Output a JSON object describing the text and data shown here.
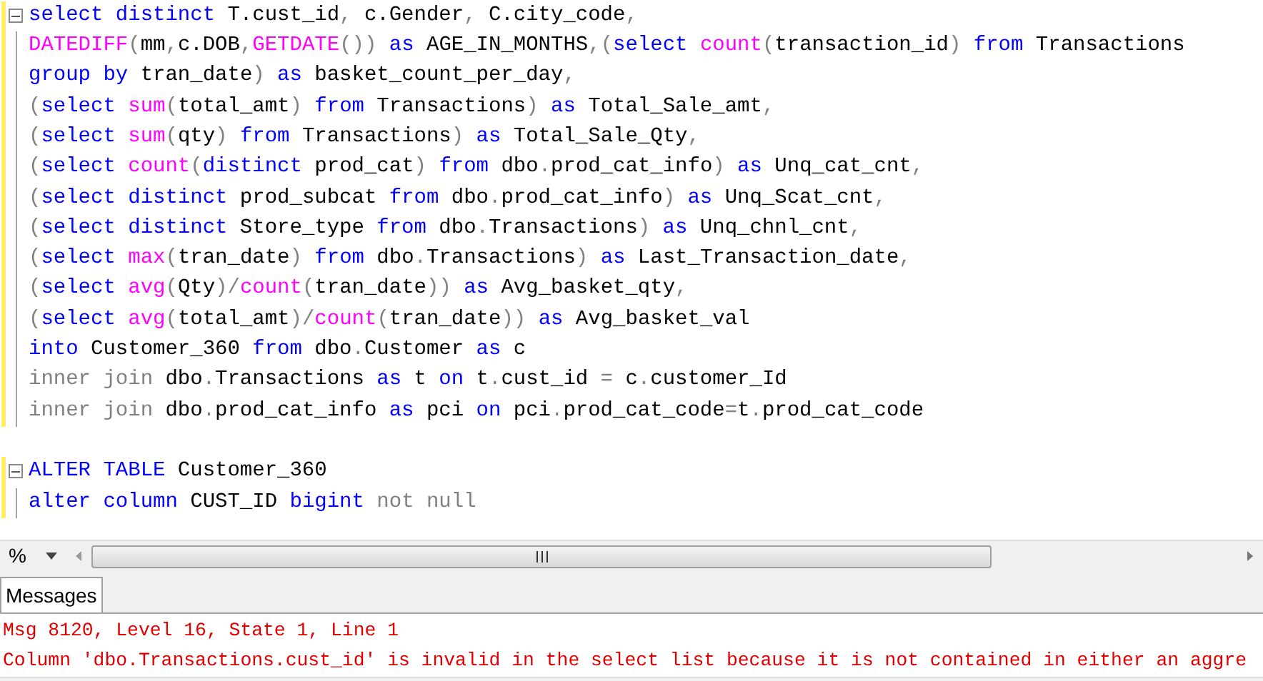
{
  "editor": {
    "blocks": [
      {
        "expanded": true,
        "lines": [
          {
            "tokens": [
              {
                "kind": "keyword",
                "text": "select distinct"
              },
              {
                "kind": "name",
                "text": " T.cust_id"
              },
              {
                "kind": "operator",
                "text": ","
              },
              {
                "kind": "name",
                "text": " c.Gender"
              },
              {
                "kind": "operator",
                "text": ","
              },
              {
                "kind": "name",
                "text": " C.city_code"
              },
              {
                "kind": "operator",
                "text": ","
              }
            ]
          },
          {
            "tokens": [
              {
                "kind": "function",
                "text": "DATEDIFF"
              },
              {
                "kind": "operator",
                "text": "("
              },
              {
                "kind": "name",
                "text": "mm"
              },
              {
                "kind": "operator",
                "text": ","
              },
              {
                "kind": "name",
                "text": "c.DOB"
              },
              {
                "kind": "operator",
                "text": ","
              },
              {
                "kind": "function",
                "text": "GETDATE"
              },
              {
                "kind": "operator",
                "text": "())"
              },
              {
                "kind": "keyword",
                "text": " as"
              },
              {
                "kind": "name",
                "text": " AGE_IN_MONTHS"
              },
              {
                "kind": "operator",
                "text": ",("
              },
              {
                "kind": "keyword",
                "text": "select"
              },
              {
                "kind": "function",
                "text": " count"
              },
              {
                "kind": "operator",
                "text": "("
              },
              {
                "kind": "name",
                "text": "transaction_id"
              },
              {
                "kind": "operator",
                "text": ")"
              },
              {
                "kind": "keyword",
                "text": " from"
              },
              {
                "kind": "name",
                "text": " Transactions"
              }
            ]
          },
          {
            "tokens": [
              {
                "kind": "keyword",
                "text": "group by"
              },
              {
                "kind": "name",
                "text": " tran_date"
              },
              {
                "kind": "operator",
                "text": ")"
              },
              {
                "kind": "keyword",
                "text": " as"
              },
              {
                "kind": "name",
                "text": " basket_count_per_day"
              },
              {
                "kind": "operator",
                "text": ","
              }
            ]
          },
          {
            "tokens": [
              {
                "kind": "operator",
                "text": "("
              },
              {
                "kind": "keyword",
                "text": "select"
              },
              {
                "kind": "function",
                "text": " sum"
              },
              {
                "kind": "operator",
                "text": "("
              },
              {
                "kind": "name",
                "text": "total_amt"
              },
              {
                "kind": "operator",
                "text": ")"
              },
              {
                "kind": "keyword",
                "text": " from"
              },
              {
                "kind": "name",
                "text": " Transactions"
              },
              {
                "kind": "operator",
                "text": ")"
              },
              {
                "kind": "keyword",
                "text": " as"
              },
              {
                "kind": "name",
                "text": " Total_Sale_amt"
              },
              {
                "kind": "operator",
                "text": ","
              }
            ]
          },
          {
            "tokens": [
              {
                "kind": "operator",
                "text": "("
              },
              {
                "kind": "keyword",
                "text": "select"
              },
              {
                "kind": "function",
                "text": " sum"
              },
              {
                "kind": "operator",
                "text": "("
              },
              {
                "kind": "name",
                "text": "qty"
              },
              {
                "kind": "operator",
                "text": ")"
              },
              {
                "kind": "keyword",
                "text": " from"
              },
              {
                "kind": "name",
                "text": " Transactions"
              },
              {
                "kind": "operator",
                "text": ")"
              },
              {
                "kind": "keyword",
                "text": " as"
              },
              {
                "kind": "name",
                "text": " Total_Sale_Qty"
              },
              {
                "kind": "operator",
                "text": ","
              }
            ]
          },
          {
            "tokens": [
              {
                "kind": "operator",
                "text": "("
              },
              {
                "kind": "keyword",
                "text": "select"
              },
              {
                "kind": "function",
                "text": " count"
              },
              {
                "kind": "operator",
                "text": "("
              },
              {
                "kind": "keyword",
                "text": "distinct"
              },
              {
                "kind": "name",
                "text": " prod_cat"
              },
              {
                "kind": "operator",
                "text": ")"
              },
              {
                "kind": "keyword",
                "text": " from"
              },
              {
                "kind": "name",
                "text": " dbo"
              },
              {
                "kind": "operator",
                "text": "."
              },
              {
                "kind": "name",
                "text": "prod_cat_info"
              },
              {
                "kind": "operator",
                "text": ")"
              },
              {
                "kind": "keyword",
                "text": " as"
              },
              {
                "kind": "name",
                "text": " Unq_cat_cnt"
              },
              {
                "kind": "operator",
                "text": ","
              }
            ]
          },
          {
            "tokens": [
              {
                "kind": "operator",
                "text": "("
              },
              {
                "kind": "keyword",
                "text": "select distinct"
              },
              {
                "kind": "name",
                "text": " prod_subcat"
              },
              {
                "kind": "keyword",
                "text": " from"
              },
              {
                "kind": "name",
                "text": " dbo"
              },
              {
                "kind": "operator",
                "text": "."
              },
              {
                "kind": "name",
                "text": "prod_cat_info"
              },
              {
                "kind": "operator",
                "text": ")"
              },
              {
                "kind": "keyword",
                "text": " as"
              },
              {
                "kind": "name",
                "text": " Unq_Scat_cnt"
              },
              {
                "kind": "operator",
                "text": ","
              }
            ]
          },
          {
            "tokens": [
              {
                "kind": "operator",
                "text": "("
              },
              {
                "kind": "keyword",
                "text": "select distinct"
              },
              {
                "kind": "name",
                "text": " Store_type"
              },
              {
                "kind": "keyword",
                "text": " from"
              },
              {
                "kind": "name",
                "text": " dbo"
              },
              {
                "kind": "operator",
                "text": "."
              },
              {
                "kind": "name",
                "text": "Transactions"
              },
              {
                "kind": "operator",
                "text": ")"
              },
              {
                "kind": "keyword",
                "text": " as"
              },
              {
                "kind": "name",
                "text": " Unq_chnl_cnt"
              },
              {
                "kind": "operator",
                "text": ","
              }
            ]
          },
          {
            "tokens": [
              {
                "kind": "operator",
                "text": "("
              },
              {
                "kind": "keyword",
                "text": "select"
              },
              {
                "kind": "function",
                "text": " max"
              },
              {
                "kind": "operator",
                "text": "("
              },
              {
                "kind": "name",
                "text": "tran_date"
              },
              {
                "kind": "operator",
                "text": ")"
              },
              {
                "kind": "keyword",
                "text": " from"
              },
              {
                "kind": "name",
                "text": " dbo"
              },
              {
                "kind": "operator",
                "text": "."
              },
              {
                "kind": "name",
                "text": "Transactions"
              },
              {
                "kind": "operator",
                "text": ")"
              },
              {
                "kind": "keyword",
                "text": " as"
              },
              {
                "kind": "name",
                "text": " Last_Transaction_date"
              },
              {
                "kind": "operator",
                "text": ","
              }
            ]
          },
          {
            "tokens": [
              {
                "kind": "operator",
                "text": "("
              },
              {
                "kind": "keyword",
                "text": "select"
              },
              {
                "kind": "function",
                "text": " avg"
              },
              {
                "kind": "operator",
                "text": "("
              },
              {
                "kind": "name",
                "text": "Qty"
              },
              {
                "kind": "operator",
                "text": ")/"
              },
              {
                "kind": "function",
                "text": "count"
              },
              {
                "kind": "operator",
                "text": "("
              },
              {
                "kind": "name",
                "text": "tran_date"
              },
              {
                "kind": "operator",
                "text": "))"
              },
              {
                "kind": "keyword",
                "text": " as"
              },
              {
                "kind": "name",
                "text": " Avg_basket_qty"
              },
              {
                "kind": "operator",
                "text": ","
              }
            ]
          },
          {
            "tokens": [
              {
                "kind": "operator",
                "text": "("
              },
              {
                "kind": "keyword",
                "text": "select"
              },
              {
                "kind": "function",
                "text": " avg"
              },
              {
                "kind": "operator",
                "text": "("
              },
              {
                "kind": "name",
                "text": "total_amt"
              },
              {
                "kind": "operator",
                "text": ")/"
              },
              {
                "kind": "function",
                "text": "count"
              },
              {
                "kind": "operator",
                "text": "("
              },
              {
                "kind": "name",
                "text": "tran_date"
              },
              {
                "kind": "operator",
                "text": "))"
              },
              {
                "kind": "keyword",
                "text": " as"
              },
              {
                "kind": "name",
                "text": " Avg_basket_val"
              }
            ]
          },
          {
            "tokens": [
              {
                "kind": "keyword",
                "text": "into"
              },
              {
                "kind": "name",
                "text": " Customer_360"
              },
              {
                "kind": "keyword",
                "text": " from"
              },
              {
                "kind": "name",
                "text": " dbo"
              },
              {
                "kind": "operator",
                "text": "."
              },
              {
                "kind": "name",
                "text": "Customer"
              },
              {
                "kind": "keyword",
                "text": " as"
              },
              {
                "kind": "name",
                "text": " c"
              }
            ]
          },
          {
            "tokens": [
              {
                "kind": "operator",
                "text": "inner join"
              },
              {
                "kind": "name",
                "text": " dbo"
              },
              {
                "kind": "operator",
                "text": "."
              },
              {
                "kind": "name",
                "text": "Transactions"
              },
              {
                "kind": "keyword",
                "text": " as"
              },
              {
                "kind": "name",
                "text": " t"
              },
              {
                "kind": "keyword",
                "text": " on"
              },
              {
                "kind": "name",
                "text": " t"
              },
              {
                "kind": "operator",
                "text": "."
              },
              {
                "kind": "name",
                "text": "cust_id"
              },
              {
                "kind": "operator",
                "text": " ="
              },
              {
                "kind": "name",
                "text": " c"
              },
              {
                "kind": "operator",
                "text": "."
              },
              {
                "kind": "name",
                "text": "customer_Id"
              }
            ]
          },
          {
            "tokens": [
              {
                "kind": "operator",
                "text": "inner join"
              },
              {
                "kind": "name",
                "text": " dbo"
              },
              {
                "kind": "operator",
                "text": "."
              },
              {
                "kind": "name",
                "text": "prod_cat_info"
              },
              {
                "kind": "keyword",
                "text": " as"
              },
              {
                "kind": "name",
                "text": " pci"
              },
              {
                "kind": "keyword",
                "text": " on"
              },
              {
                "kind": "name",
                "text": " pci"
              },
              {
                "kind": "operator",
                "text": "."
              },
              {
                "kind": "name",
                "text": "prod_cat_code"
              },
              {
                "kind": "operator",
                "text": "="
              },
              {
                "kind": "name",
                "text": "t"
              },
              {
                "kind": "operator",
                "text": "."
              },
              {
                "kind": "name",
                "text": "prod_cat_code"
              }
            ]
          }
        ]
      },
      {
        "expanded": true,
        "lines": [
          {
            "tokens": [
              {
                "kind": "keyword",
                "text": "ALTER TABLE"
              },
              {
                "kind": "name",
                "text": " Customer_360"
              }
            ]
          },
          {
            "tokens": [
              {
                "kind": "keyword",
                "text": "alter column"
              },
              {
                "kind": "name",
                "text": " CUST_ID"
              },
              {
                "kind": "keyword",
                "text": " bigint"
              },
              {
                "kind": "operator",
                "text": " not null"
              }
            ]
          }
        ]
      }
    ]
  },
  "zoom": {
    "value": "%"
  },
  "results": {
    "tabs": [
      {
        "label": "Messages",
        "selected": true
      }
    ],
    "messages": [
      "Msg 8120, Level 16, State 1, Line 1",
      "Column 'dbo.Transactions.cust_id' is invalid in the select list because it is not contained in either an aggre"
    ]
  }
}
